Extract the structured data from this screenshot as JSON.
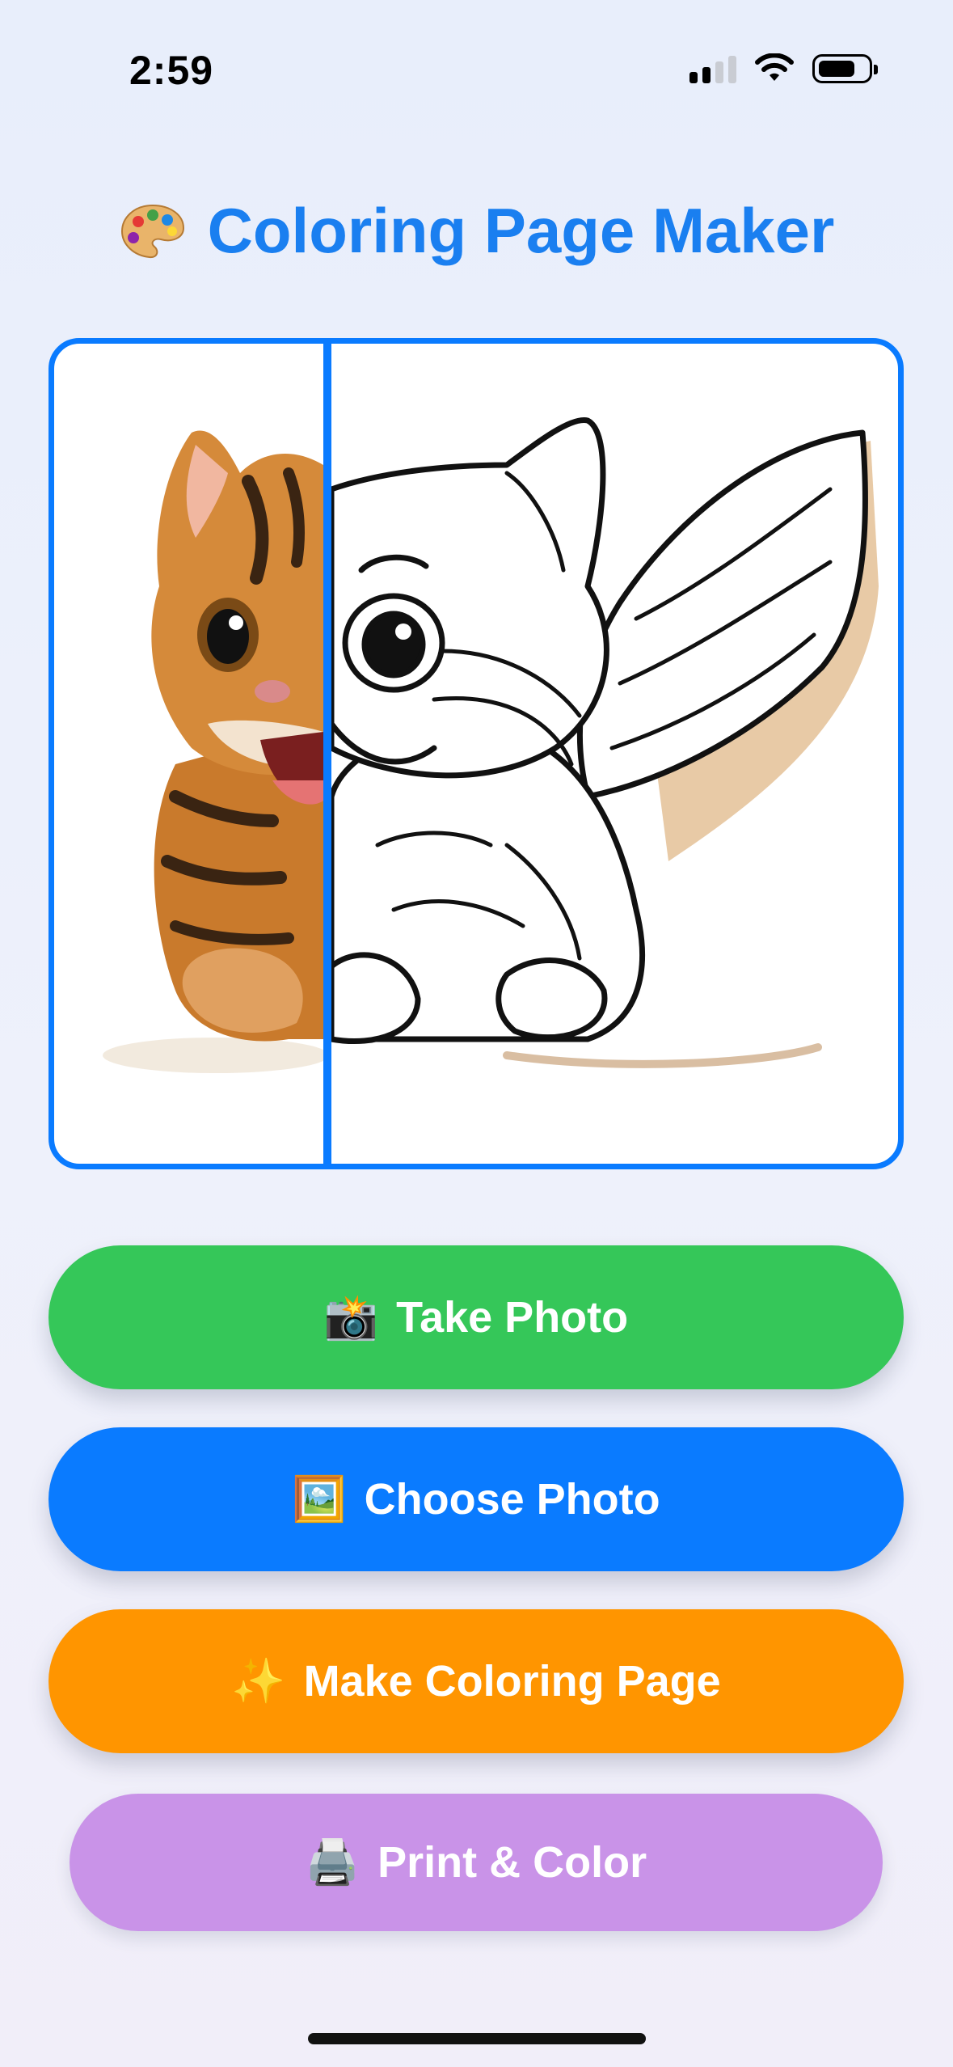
{
  "status_bar": {
    "time": "2:59"
  },
  "title": {
    "text": "Coloring Page Maker",
    "icon": "palette-icon"
  },
  "buttons": {
    "take_photo": {
      "icon": "📸",
      "label": "Take Photo",
      "color": "#35c759"
    },
    "choose_photo": {
      "icon": "🖼️",
      "label": "Choose Photo",
      "color": "#0a7bff"
    },
    "make_page": {
      "icon": "✨",
      "label": "Make Coloring Page",
      "color": "#ff9500"
    },
    "print": {
      "icon": "🖨️",
      "label": "Print & Color",
      "color": "#c993e8"
    }
  },
  "colors": {
    "accent": "#0a7bff",
    "title": "#1a7ff0"
  }
}
